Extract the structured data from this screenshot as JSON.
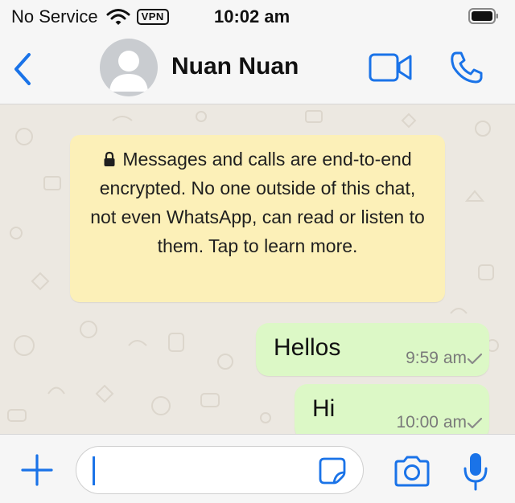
{
  "status_bar": {
    "carrier": "No Service",
    "vpn": "VPN",
    "time": "10:02 am",
    "icons": [
      "wifi-icon",
      "battery-icon"
    ]
  },
  "header": {
    "contact_name": "Nuan Nuan",
    "icons": [
      "back-chevron-icon",
      "avatar-placeholder-icon",
      "video-camera-icon",
      "phone-icon"
    ]
  },
  "chat": {
    "encryption_notice": "Messages and calls are end-to-end encrypted. No one outside of this chat, not even WhatsApp, can read or listen to them. Tap to learn more.",
    "messages": [
      {
        "text": "Hellos",
        "time": "9:59 am",
        "status": "sent"
      },
      {
        "text": "Hi",
        "time": "10:00 am",
        "status": "sent"
      }
    ]
  },
  "input_bar": {
    "value": "",
    "icons": [
      "plus-icon",
      "sticker-icon",
      "camera-icon",
      "microphone-icon"
    ]
  },
  "colors": {
    "accent": "#1a73e8",
    "outgoing_bubble": "#dcf8c6",
    "notice_bg": "#fcf0b8",
    "chat_bg": "#ece8e1"
  }
}
